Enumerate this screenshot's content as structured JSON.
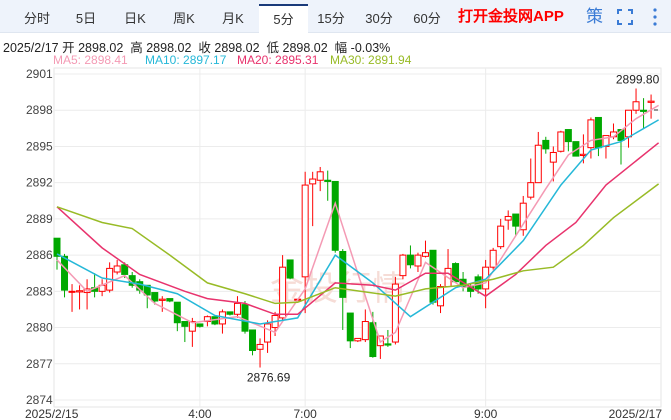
{
  "tabs": [
    "分时",
    "5日",
    "日K",
    "周K",
    "月K",
    "5分",
    "15分",
    "30分",
    "60分"
  ],
  "active_tab": "5分",
  "app_link": "打开金投网APP",
  "strategy_label": "策",
  "info": {
    "date": "2025/2/17",
    "open_label": "开",
    "open": "2898.02",
    "high_label": "高",
    "high": "2898.02",
    "close_label": "收",
    "close": "2898.02",
    "low_label": "低",
    "low": "2898.02",
    "change_label": "幅",
    "change": "-0.03%"
  },
  "ma_legend": {
    "ma5": "MA5: 2898.41",
    "ma10": "MA10: 2897.17",
    "ma20": "MA20: 2895.31",
    "ma30": "MA30: 2891.94"
  },
  "colors": {
    "up": "#ff0000",
    "down": "#00a800",
    "ma5": "#f49ab4",
    "ma10": "#25b8d8",
    "ma20": "#e8336d",
    "ma30": "#98bb26"
  },
  "chart_data": {
    "type": "candlestick",
    "ylim": [
      2874,
      2901
    ],
    "y_ticks": [
      "2901",
      "2898",
      "2895",
      "2892",
      "2889",
      "2886",
      "2883",
      "2880",
      "2877",
      "2874"
    ],
    "x_ticks": [
      {
        "label": "2025/2/15",
        "idx": 0
      },
      {
        "label": "4:00",
        "idx": 19
      },
      {
        "label": "7:00",
        "idx": 33
      },
      {
        "label": "9:00",
        "idx": 57
      },
      {
        "label": "2025/2/17",
        "idx": 80
      }
    ],
    "max_label": "2899.80",
    "min_label": "2876.69",
    "max_idx": 78,
    "max_val": 2899.8,
    "min_idx": 28,
    "min_val": 2876.69,
    "candles": [
      [
        2887.4,
        2887.4,
        2884.8,
        2885.9
      ],
      [
        2885.9,
        2886.1,
        2882.5,
        2883.1
      ],
      [
        2883.0,
        2883.6,
        2881.3,
        2883.0
      ],
      [
        2882.95,
        2883.5,
        2881.5,
        2883.05
      ],
      [
        2882.9,
        2884,
        2881.5,
        2883.2
      ],
      [
        2883.3,
        2884.5,
        2882.5,
        2883.0
      ],
      [
        2883.0,
        2884,
        2882.6,
        2883.5
      ],
      [
        2883.1,
        2885.4,
        2882.9,
        2884.9
      ],
      [
        2884.6,
        2885.6,
        2884.4,
        2885.1
      ],
      [
        2885.2,
        2885.4,
        2884.1,
        2884.4
      ],
      [
        2884.3,
        2884.6,
        2883.3,
        2883.5
      ],
      [
        2883.8,
        2884,
        2882.8,
        2883.1
      ],
      [
        2883.5,
        2883.5,
        2881.6,
        2882.7
      ],
      [
        2882.9,
        2882.9,
        2881.9,
        2882.2
      ],
      [
        2882.25,
        2882.6,
        2881.3,
        2882.35
      ],
      [
        2882.4,
        2882.4,
        2882.1,
        2882.2
      ],
      [
        2882.1,
        2882.1,
        2879.7,
        2880.4
      ],
      [
        2880.5,
        2880.5,
        2878.8,
        2880.1
      ],
      [
        2879.7,
        2880.8,
        2878.4,
        2880.5
      ],
      [
        2880.3,
        2880.3,
        2880.0,
        2880.1
      ],
      [
        2880.5,
        2881,
        2880.1,
        2880.9
      ],
      [
        2880.9,
        2880.9,
        2880.2,
        2880.3
      ],
      [
        2880.3,
        2881.5,
        2879.5,
        2881.3
      ],
      [
        2881.3,
        2881.3,
        2881.0,
        2881.1
      ],
      [
        2881.1,
        2882.6,
        2880.8,
        2882.0
      ],
      [
        2881.9,
        2882.2,
        2879.5,
        2879.7
      ],
      [
        2879.8,
        2879.8,
        2877.7,
        2878.1
      ],
      [
        2878.2,
        2879.1,
        2876.69,
        2878.6
      ],
      [
        2878.8,
        2880.6,
        2877.9,
        2880.3
      ],
      [
        2880.0,
        2881.3,
        2879.3,
        2881.0
      ],
      [
        2880.8,
        2886.0,
        2880.6,
        2885.0
      ],
      [
        2885.6,
        2885.6,
        2884.0,
        2884.1
      ],
      [
        2882.3,
        2882.3,
        2882.2,
        2882.35
      ],
      [
        2884.2,
        2892.9,
        2881.2,
        2891.8
      ],
      [
        2891.9,
        2892.9,
        2888.4,
        2892.3
      ],
      [
        2892.2,
        2893.3,
        2891.3,
        2892.9
      ],
      [
        2892.2,
        2893.0,
        2890.5,
        2892.1
      ],
      [
        2892.1,
        2892.1,
        2886.2,
        2886.4
      ],
      [
        2886.3,
        2886.5,
        2879.8,
        2882.5
      ],
      [
        2881.2,
        2881.2,
        2878.3,
        2878.9
      ],
      [
        2878.9,
        2879.1,
        2878.8,
        2879.1
      ],
      [
        2879.0,
        2881.5,
        2878.8,
        2880.5
      ],
      [
        2880.4,
        2881.3,
        2877.5,
        2877.6
      ],
      [
        2878.5,
        2879.3,
        2877.4,
        2879.3
      ],
      [
        2878.65,
        2879.8,
        2878.4,
        2878.55
      ],
      [
        2878.8,
        2884.2,
        2878.6,
        2883.6
      ],
      [
        2884.3,
        2886.1,
        2884.0,
        2886.0
      ],
      [
        2886.0,
        2886.8,
        2884.9,
        2885.2
      ],
      [
        2885.1,
        2886.2,
        2884.6,
        2886.0
      ],
      [
        2885.9,
        2887.2,
        2885.8,
        2886.2
      ],
      [
        2886.4,
        2886.4,
        2881.9,
        2882.1
      ],
      [
        2881.8,
        2883.6,
        2881.2,
        2883.4
      ],
      [
        2883.4,
        2886.5,
        2883.4,
        2884.9
      ],
      [
        2885.3,
        2885.4,
        2883.8,
        2883.8
      ],
      [
        2884.0,
        2884.6,
        2883.0,
        2883.4
      ],
      [
        2883.4,
        2883.6,
        2882.5,
        2883.0
      ],
      [
        2884.2,
        2884.4,
        2882.8,
        2883.2
      ],
      [
        2883.2,
        2885.6,
        2881.6,
        2885.0
      ],
      [
        2885.0,
        2886.6,
        2884.8,
        2886.4
      ],
      [
        2886.7,
        2889.0,
        2886.5,
        2888.4
      ],
      [
        2888.9,
        2889.7,
        2888.1,
        2889.2
      ],
      [
        2889.4,
        2889.4,
        2887.6,
        2888.4
      ],
      [
        2888.1,
        2890.9,
        2887.6,
        2890.3
      ],
      [
        2890.8,
        2894.0,
        2890.6,
        2892.0
      ],
      [
        2892.0,
        2896.2,
        2892.0,
        2895.1
      ],
      [
        2895.5,
        2895.8,
        2894.4,
        2894.8
      ],
      [
        2893.7,
        2895.0,
        2892.1,
        2894.5
      ],
      [
        2894.6,
        2896.3,
        2894.5,
        2896.2
      ],
      [
        2896.4,
        2896.4,
        2894.6,
        2895.4
      ],
      [
        2895.4,
        2895.4,
        2894.2,
        2894.2
      ],
      [
        2894.25,
        2896.0,
        2893.6,
        2894.35
      ],
      [
        2894.9,
        2897.4,
        2894.0,
        2897.2
      ],
      [
        2897.4,
        2897.4,
        2894.2,
        2894.9
      ],
      [
        2895.0,
        2895.9,
        2894.0,
        2895.9
      ],
      [
        2895.8,
        2896.9,
        2895.6,
        2896.2
      ],
      [
        2896.4,
        2896.4,
        2893.5,
        2895.5
      ],
      [
        2895.8,
        2898.0,
        2894.9,
        2898.0
      ],
      [
        2898.0,
        2899.8,
        2897.7,
        2898.7
      ],
      [
        2898.0,
        2899.0,
        2896.5,
        2897.9
      ],
      [
        2898.65,
        2899.3,
        2897.3,
        2898.75
      ]
    ],
    "series": [
      {
        "name": "MA5",
        "points": [
          [
            0,
            2885.6
          ],
          [
            4,
            2883.0
          ],
          [
            9,
            2884.3
          ],
          [
            13,
            2882.0
          ],
          [
            18,
            2880.4
          ],
          [
            24,
            2880.9
          ],
          [
            29,
            2879.6
          ],
          [
            33,
            2883.2
          ],
          [
            37,
            2890.3
          ],
          [
            40,
            2884.5
          ],
          [
            43,
            2878.8
          ],
          [
            45,
            2879.6
          ],
          [
            49,
            2885.4
          ],
          [
            54,
            2883.3
          ],
          [
            57,
            2883.7
          ],
          [
            61,
            2887.6
          ],
          [
            65,
            2891.5
          ],
          [
            68,
            2894.3
          ],
          [
            71,
            2895.5
          ],
          [
            74,
            2895.8
          ],
          [
            77,
            2897.3
          ],
          [
            80,
            2898.4
          ]
        ]
      },
      {
        "name": "MA10",
        "points": [
          [
            0,
            2886.1
          ],
          [
            6,
            2884.1
          ],
          [
            11,
            2883.6
          ],
          [
            16,
            2882.8
          ],
          [
            21,
            2881.0
          ],
          [
            27,
            2880.3
          ],
          [
            32,
            2880.8
          ],
          [
            37,
            2886.0
          ],
          [
            42,
            2883.7
          ],
          [
            47,
            2880.9
          ],
          [
            53,
            2883.3
          ],
          [
            57,
            2884.0
          ],
          [
            62,
            2887.2
          ],
          [
            67,
            2891.8
          ],
          [
            71,
            2894.7
          ],
          [
            75,
            2895.4
          ],
          [
            80,
            2897.2
          ]
        ]
      },
      {
        "name": "MA20",
        "points": [
          [
            0,
            2890.0
          ],
          [
            6,
            2886.6
          ],
          [
            11,
            2884.4
          ],
          [
            17,
            2883.0
          ],
          [
            20,
            2882.4
          ],
          [
            25,
            2882.0
          ],
          [
            29,
            2881.1
          ],
          [
            32,
            2881.1
          ],
          [
            37,
            2883.7
          ],
          [
            42,
            2883.5
          ],
          [
            45,
            2883.1
          ],
          [
            49,
            2884.5
          ],
          [
            52,
            2884.5
          ],
          [
            57,
            2882.6
          ],
          [
            61,
            2884.4
          ],
          [
            65,
            2886.8
          ],
          [
            69,
            2888.7
          ],
          [
            73,
            2891.8
          ],
          [
            80,
            2895.3
          ]
        ]
      },
      {
        "name": "MA30",
        "points": [
          [
            0,
            2890.0
          ],
          [
            6,
            2888.7
          ],
          [
            10,
            2888.2
          ],
          [
            15,
            2886.0
          ],
          [
            20,
            2883.7
          ],
          [
            25,
            2882.8
          ],
          [
            29,
            2882.0
          ],
          [
            32,
            2882.1
          ],
          [
            37,
            2883.3
          ],
          [
            45,
            2882.6
          ],
          [
            49,
            2883.2
          ],
          [
            54,
            2883.5
          ],
          [
            58,
            2884.0
          ],
          [
            62,
            2884.7
          ],
          [
            66,
            2885.0
          ],
          [
            70,
            2886.8
          ],
          [
            74,
            2889.1
          ],
          [
            80,
            2891.9
          ]
        ]
      }
    ]
  }
}
